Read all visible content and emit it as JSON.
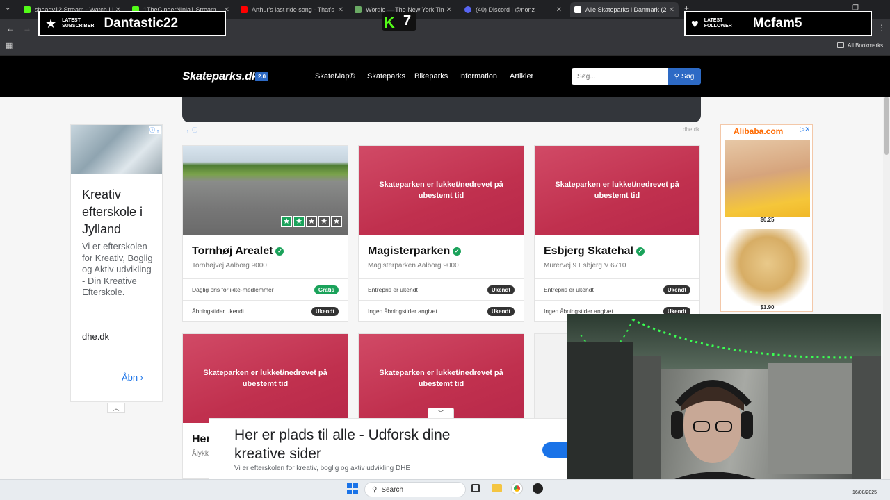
{
  "browser": {
    "tabs": [
      {
        "title": "sheady12 Stream - Watch Liv",
        "color": "#53fc18",
        "active": false
      },
      {
        "title": "1TheGingerNinja1 Stream",
        "color": "#53fc18",
        "active": false
      },
      {
        "title": "Arthur's last ride song - That's",
        "color": "#ff0000",
        "active": false
      },
      {
        "title": "Wordle — The New York Times",
        "color": "#6aaa64",
        "active": false
      },
      {
        "title": "(40) Discord | @nonz",
        "color": "#5865f2",
        "active": false
      },
      {
        "title": "Alle Skateparks i Danmark (250",
        "color": "#ffffff",
        "active": true
      }
    ],
    "all_bookmarks": "All Bookmarks"
  },
  "overlays": {
    "subscriber_label_1": "LATEST",
    "subscriber_label_2": "SUBSCRIBER",
    "subscriber_name": "Dantastic22",
    "follower_label_1": "LATEST",
    "follower_label_2": "FOLLOWER",
    "follower_name": "Mcfam5",
    "kick_count": "7"
  },
  "site": {
    "logo": "Skateparks.dk",
    "version": "2.0",
    "nav": [
      "SkateMap®",
      "Skateparks",
      "Bikeparks",
      "Information",
      "Artikler"
    ],
    "search_placeholder": "Søg...",
    "search_button": "Søg",
    "ad_domain": "dhe.dk"
  },
  "left_ad": {
    "title": "Kreativ efterskole i Jylland",
    "body": "Vi er efterskolen for Kreativ, Boglig og Aktiv udvikling - Din Kreative Efterskole.",
    "domain": "dhe.dk",
    "open_label": "Åbn"
  },
  "right_ad": {
    "brand": "Alibaba.com",
    "prices": [
      "$0.25",
      "$1.90"
    ]
  },
  "cards": [
    {
      "title": "Tornhøj Arealet",
      "address": "Tornhøjvej Aalborg 9000",
      "closed": false,
      "row1_label": "Daglig pris for ikke-medlemmer",
      "row1_value": "Gratis",
      "row2_label": "Åbningstider ukendt",
      "row2_value": "Ukendt",
      "rating": 2,
      "rating_max": 5
    },
    {
      "title": "Magisterparken",
      "address": "Magisterparken Aalborg 9000",
      "closed": true,
      "closed_text": "Skateparken er lukket/nedrevet på ubestemt tid",
      "row1_label": "Entrépris er ukendt",
      "row1_value": "Ukendt",
      "row2_label": "Ingen åbningstider angivet",
      "row2_value": "Ukendt"
    },
    {
      "title": "Esbjerg Skatehal",
      "address": "Murervej 9 Esbjerg V 6710",
      "closed": true,
      "closed_text": "Skateparken er lukket/nedrevet på ubestemt tid",
      "row1_label": "Entrépris er ukendt",
      "row1_value": "Ukendt",
      "row2_label": "Ingen åbningstider angivet",
      "row2_value": "Ukendt"
    },
    {
      "title": "Her",
      "address": "Ålykk",
      "closed": true,
      "closed_text": "Skateparken er lukket/nedrevet på ubestemt tid"
    },
    {
      "closed": true,
      "closed_text": "Skateparken er lukket/nedrevet på ubestemt tid"
    }
  ],
  "bottom_ad": {
    "title": "Her er plads til alle - Udforsk dine kreative sider",
    "subtitle": "Vi er efterskolen for kreativ, boglig og aktiv udvikling DHE"
  },
  "taskbar": {
    "search_label": "Search",
    "date": "16/08/2025"
  }
}
